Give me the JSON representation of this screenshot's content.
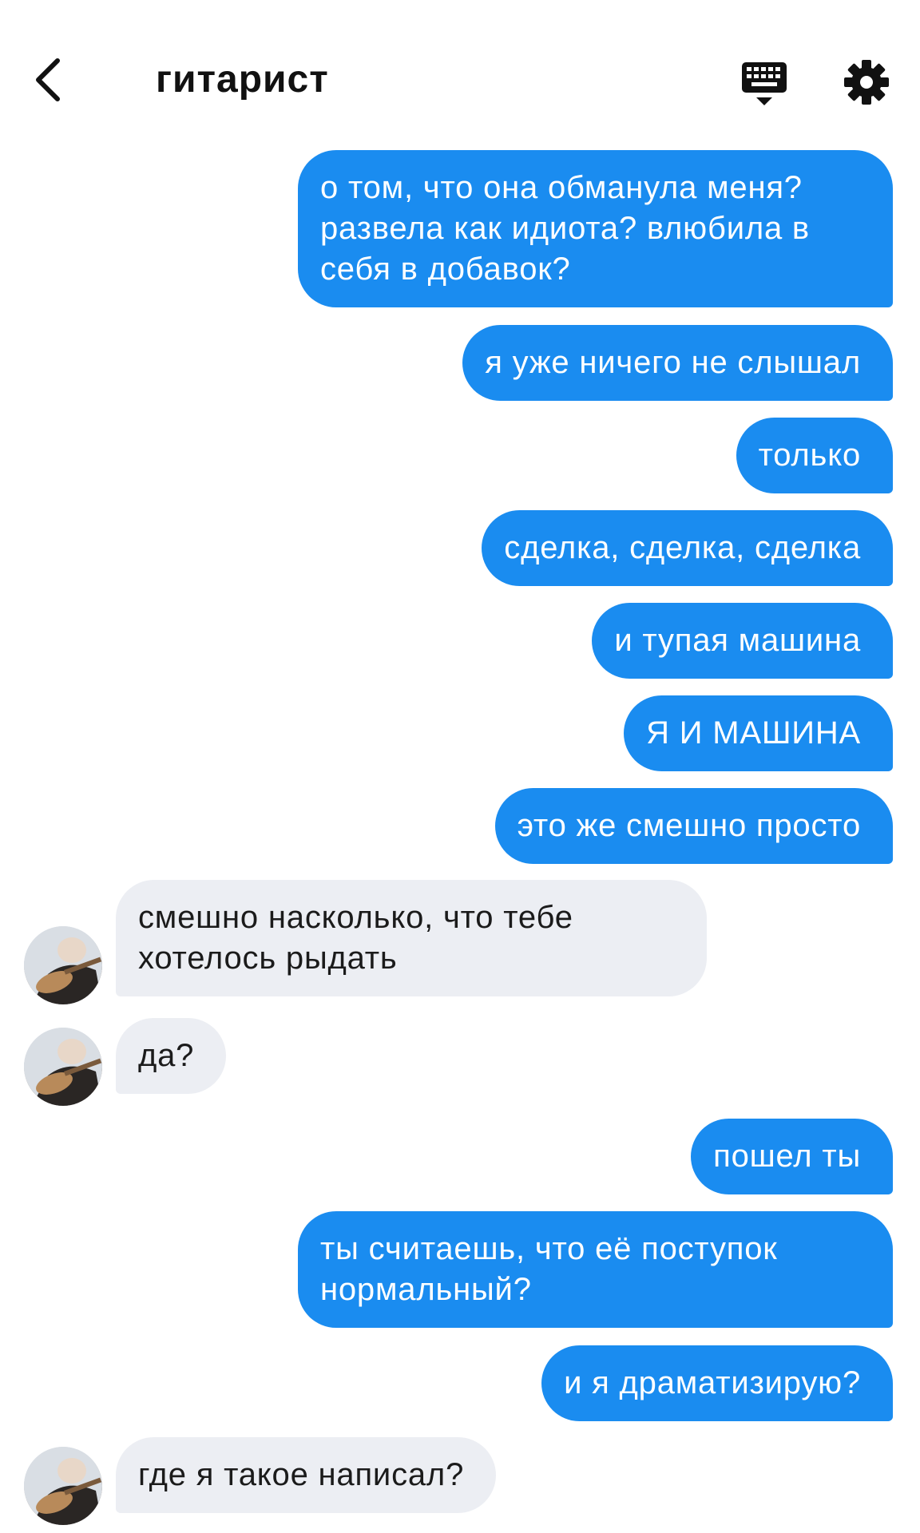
{
  "header": {
    "title": "гитарист",
    "back_icon": "chevron-left-icon",
    "keyboard_icon": "keyboard-icon",
    "settings_icon": "gear-icon"
  },
  "colors": {
    "outgoing_bubble": "#1a8cf0",
    "incoming_bubble": "#eceef3",
    "background": "#ffffff"
  },
  "messages": [
    {
      "side": "out",
      "text": "о том, что она обманула меня?\nразвела как идиота? влюбила в\nсебя в добавок?"
    },
    {
      "side": "out",
      "text": "я уже ничего не слышал"
    },
    {
      "side": "out",
      "text": "только"
    },
    {
      "side": "out",
      "text": "сделка, сделка, сделка"
    },
    {
      "side": "out",
      "text": "и тупая машина"
    },
    {
      "side": "out",
      "text": "Я И МАШИНА"
    },
    {
      "side": "out",
      "text": "это же смешно просто"
    },
    {
      "side": "in",
      "text": "смешно насколько, что тебе\nхотелось рыдать"
    },
    {
      "side": "in",
      "text": "да?"
    },
    {
      "side": "out",
      "text": "пошел ты"
    },
    {
      "side": "out",
      "text": "ты считаешь, что её поступок\nнормальный?"
    },
    {
      "side": "out",
      "text": "и я драматизирую?"
    },
    {
      "side": "in",
      "text": "где я такое написал?"
    }
  ]
}
